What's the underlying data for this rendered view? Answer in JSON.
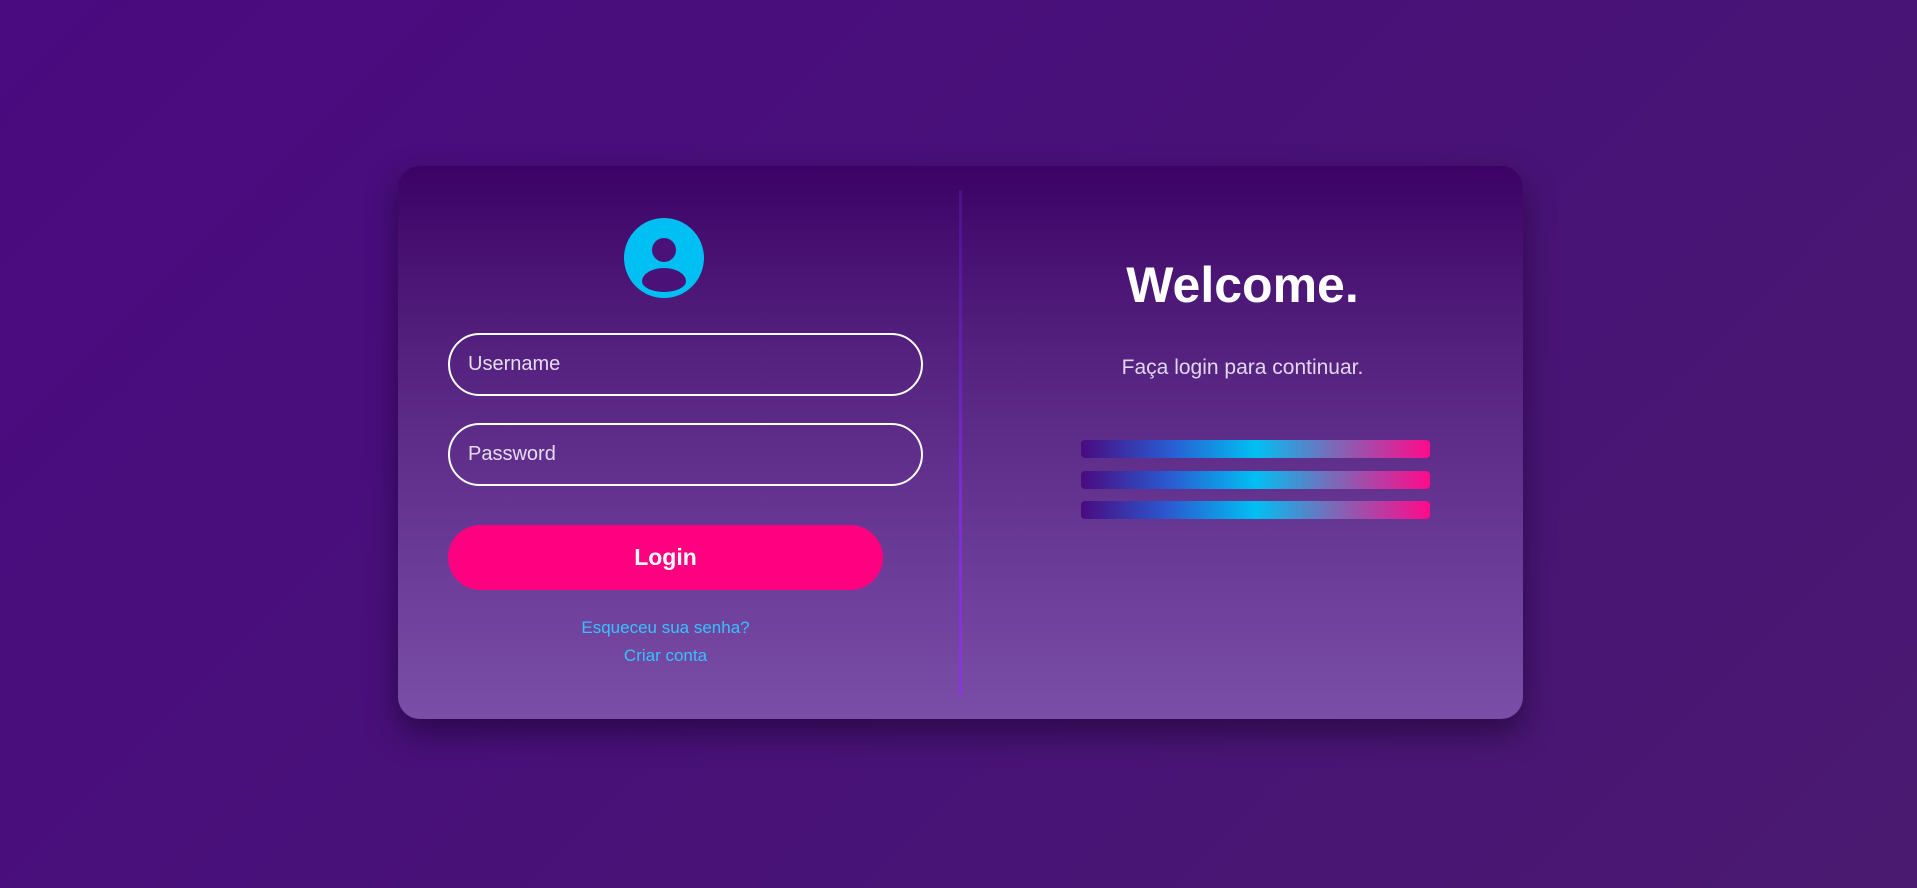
{
  "login": {
    "avatar_icon": "user-avatar-icon",
    "username_placeholder": "Username",
    "password_placeholder": "Password",
    "login_label": "Login",
    "forgot_password_label": "Esqueceu sua senha?",
    "create_account_label": "Criar conta"
  },
  "welcome": {
    "title": "Welcome.",
    "subtitle": "Faça login para continuar."
  },
  "colors": {
    "background": "#4a0a80",
    "accent_pink": "#ff0080",
    "accent_cyan": "#00c0f3",
    "link": "#35c3ff"
  }
}
